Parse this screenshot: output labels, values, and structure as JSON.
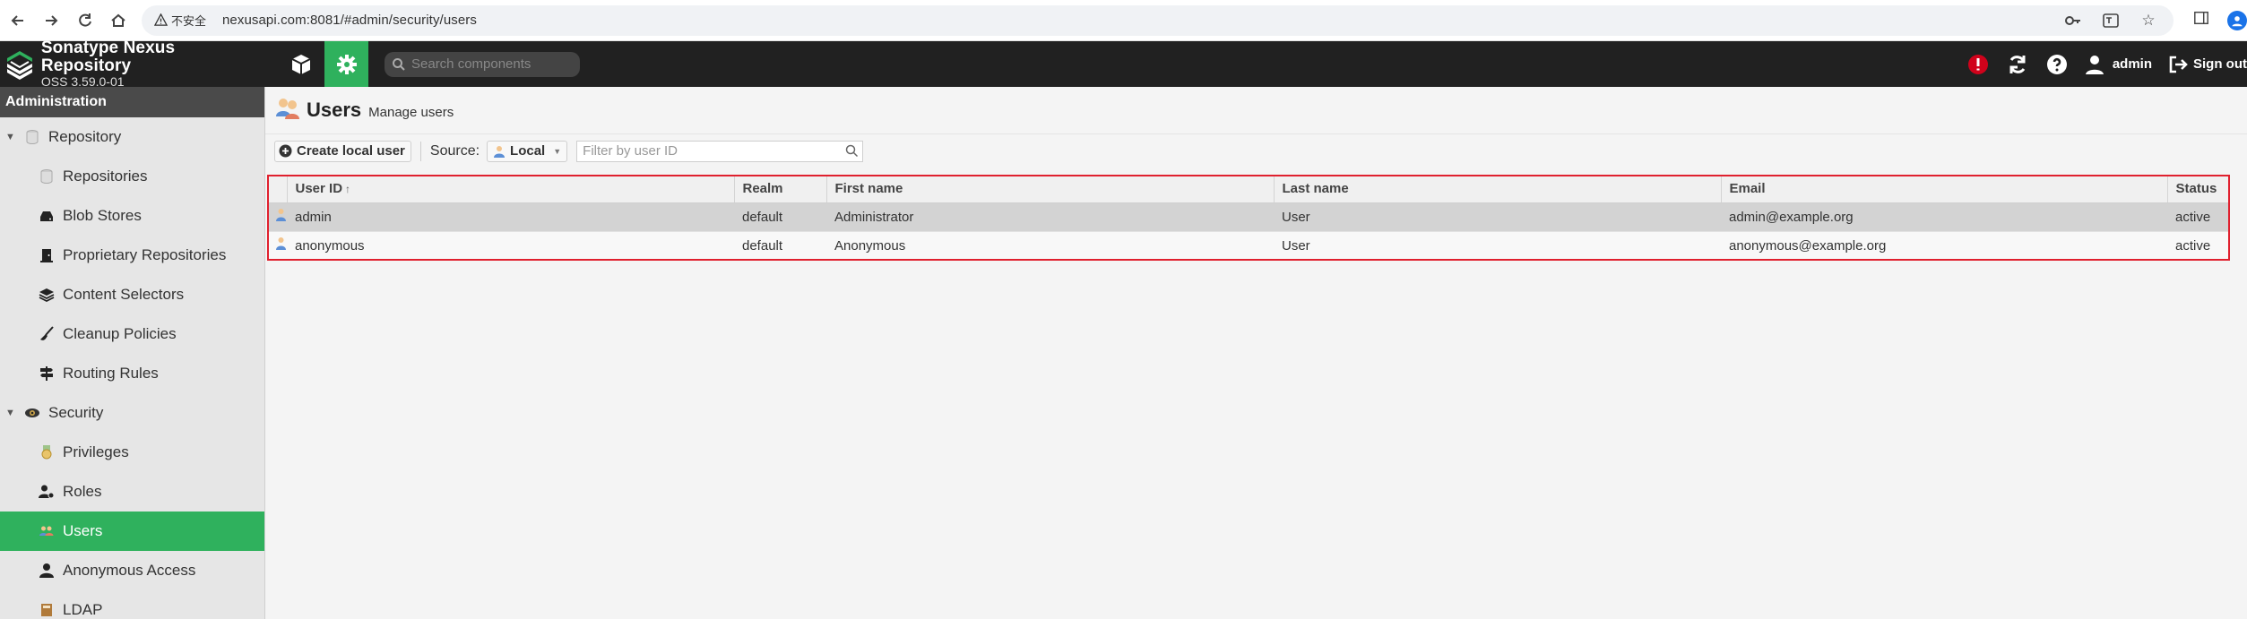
{
  "browser": {
    "security_warning": "不安全",
    "url": "nexusapi.com:8081/#admin/security/users"
  },
  "header": {
    "app_title": "Sonatype Nexus Repository",
    "version": "OSS 3.59.0-01",
    "search_placeholder": "Search components",
    "user_name": "admin",
    "sign_out": "Sign out"
  },
  "sidebar": {
    "heading": "Administration",
    "groups": [
      {
        "label": "Repository",
        "icon": "database-icon"
      },
      {
        "label": "Security",
        "icon": "eye-icon"
      }
    ],
    "repository_items": [
      {
        "label": "Repositories",
        "icon": "database-icon"
      },
      {
        "label": "Blob Stores",
        "icon": "hdd-icon"
      },
      {
        "label": "Proprietary Repositories",
        "icon": "door-icon"
      },
      {
        "label": "Content Selectors",
        "icon": "layers-icon"
      },
      {
        "label": "Cleanup Policies",
        "icon": "broom-icon"
      },
      {
        "label": "Routing Rules",
        "icon": "signpost-icon"
      }
    ],
    "security_items": [
      {
        "label": "Privileges",
        "icon": "medal-icon"
      },
      {
        "label": "Roles",
        "icon": "user-gear-icon"
      },
      {
        "label": "Users",
        "icon": "users-icon"
      },
      {
        "label": "Anonymous Access",
        "icon": "user-icon"
      },
      {
        "label": "LDAP",
        "icon": "book-icon"
      }
    ]
  },
  "main": {
    "title": "Users",
    "subtitle": "Manage users",
    "create_button": "Create local user",
    "source_label": "Source:",
    "source_value": "Local",
    "filter_placeholder": "Filter by user ID",
    "columns": [
      "User ID",
      "Realm",
      "First name",
      "Last name",
      "Email",
      "Status"
    ],
    "rows": [
      {
        "user_id": "admin",
        "realm": "default",
        "first_name": "Administrator",
        "last_name": "User",
        "email": "admin@example.org",
        "status": "active"
      },
      {
        "user_id": "anonymous",
        "realm": "default",
        "first_name": "Anonymous",
        "last_name": "User",
        "email": "anonymous@example.org",
        "status": "active"
      }
    ]
  },
  "colors": {
    "accent": "#2fb15d",
    "header_bg": "#212121",
    "highlight_outline": "#e0202e"
  }
}
